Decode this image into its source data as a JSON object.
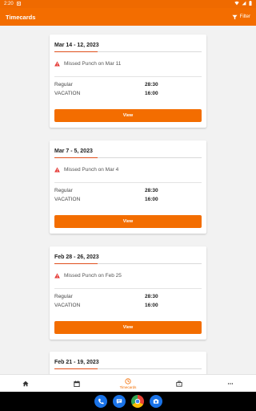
{
  "status_bar": {
    "time": "2:20"
  },
  "app_bar": {
    "title": "Timecards",
    "filter_label": "Filter"
  },
  "timecards": [
    {
      "date_range": "Mar 14 - 12, 2023",
      "alert": "Missed Punch on Mar 11",
      "hours": [
        {
          "type": "Regular",
          "value": "28:30"
        },
        {
          "type": "VACATION",
          "value": "16:00"
        }
      ],
      "button_label": "View"
    },
    {
      "date_range": "Mar 7 - 5, 2023",
      "alert": "Missed Punch on Mar 4",
      "hours": [
        {
          "type": "Regular",
          "value": "28:30"
        },
        {
          "type": "VACATION",
          "value": "16:00"
        }
      ],
      "button_label": "View"
    },
    {
      "date_range": "Feb 28 - 26, 2023",
      "alert": "Missed Punch on Feb 25",
      "hours": [
        {
          "type": "Regular",
          "value": "28:30"
        },
        {
          "type": "VACATION",
          "value": "16:00"
        }
      ],
      "button_label": "View"
    },
    {
      "date_range": "Feb 21 - 19, 2023"
    }
  ],
  "bottom_nav": {
    "items": [
      {
        "icon": "home-icon"
      },
      {
        "icon": "calendar-icon"
      },
      {
        "icon": "timecards-icon",
        "label": "Timecards",
        "active": true
      },
      {
        "icon": "briefcase-icon"
      },
      {
        "icon": "more-icon"
      }
    ]
  },
  "colors": {
    "brand": "#f36d00",
    "accent_line": "#e0501d",
    "alert": "#e53935"
  }
}
